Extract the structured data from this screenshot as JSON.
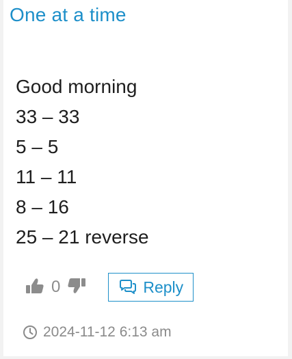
{
  "post": {
    "title": "One at a time",
    "lines": [
      "Good morning",
      "33 – 33",
      "5 – 5",
      "11 – 11",
      "8 – 16",
      "25 – 21 reverse"
    ],
    "vote_count": "0",
    "reply_label": "Reply",
    "timestamp": "2024-11-12 6:13 am"
  },
  "icons": {
    "vote_up": "thumbs-up-icon",
    "vote_down": "thumbs-down-icon",
    "reply": "comments-icon",
    "timestamp": "clock-icon"
  },
  "colors": {
    "accent": "#1d8fc9",
    "text": "#1e1e1e",
    "muted": "#8a8a8a"
  }
}
